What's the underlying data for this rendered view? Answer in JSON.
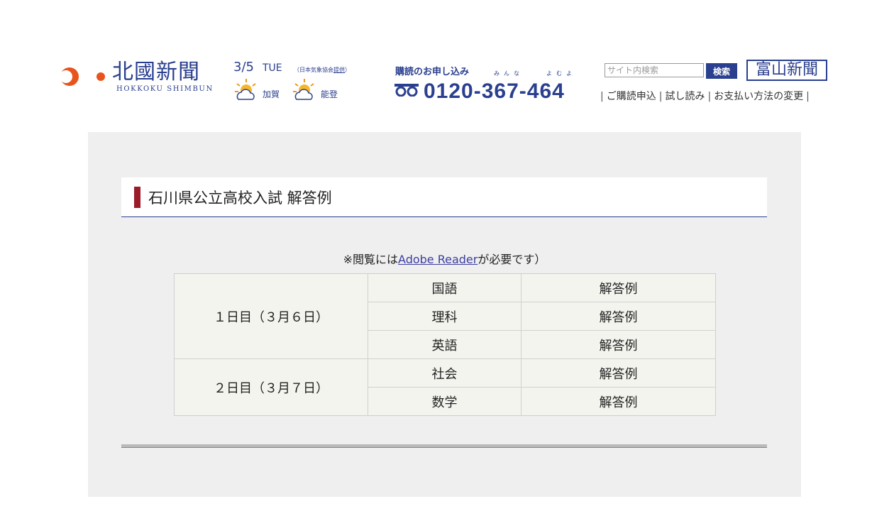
{
  "header": {
    "logo": {
      "name_jp": "北國新聞",
      "name_en": "HOKKOKU SHIMBUN"
    },
    "date": "3/5",
    "weekday": "TUE",
    "weather_credit": {
      "prefix": "（日本気象協会",
      "link": "提供",
      "suffix": "）"
    },
    "weather": [
      {
        "area": "加賀",
        "icon": "sun-cloud-icon"
      },
      {
        "area": "能登",
        "icon": "sun-cloud-icon"
      }
    ],
    "subscription": {
      "label": "購読のお申し込み",
      "kana1": "みんな",
      "kana2": "よむよ",
      "phone": "0120-367-464"
    },
    "search": {
      "placeholder": "サイト内検索",
      "value": "",
      "button": "検索"
    },
    "toyama": "富山新聞",
    "links": [
      "ご購読申込",
      "試し読み",
      "お支払い方法の変更"
    ]
  },
  "main": {
    "title": "石川県公立高校入試 解答例",
    "note": {
      "prefix": "※閲覧には",
      "link": "Adobe Reader",
      "suffix": "が必要です）"
    },
    "days": [
      {
        "label": "１日目（３月６日）",
        "subjects": [
          {
            "name": "国語",
            "link": "解答例"
          },
          {
            "name": "理科",
            "link": "解答例"
          },
          {
            "name": "英語",
            "link": "解答例"
          }
        ]
      },
      {
        "label": "２日目（３月７日）",
        "subjects": [
          {
            "name": "社会",
            "link": "解答例"
          },
          {
            "name": "数学",
            "link": "解答例"
          }
        ]
      }
    ]
  },
  "colors": {
    "brand": "#2a3f8f",
    "accent": "#9b1b2a",
    "panel": "#efefef"
  }
}
